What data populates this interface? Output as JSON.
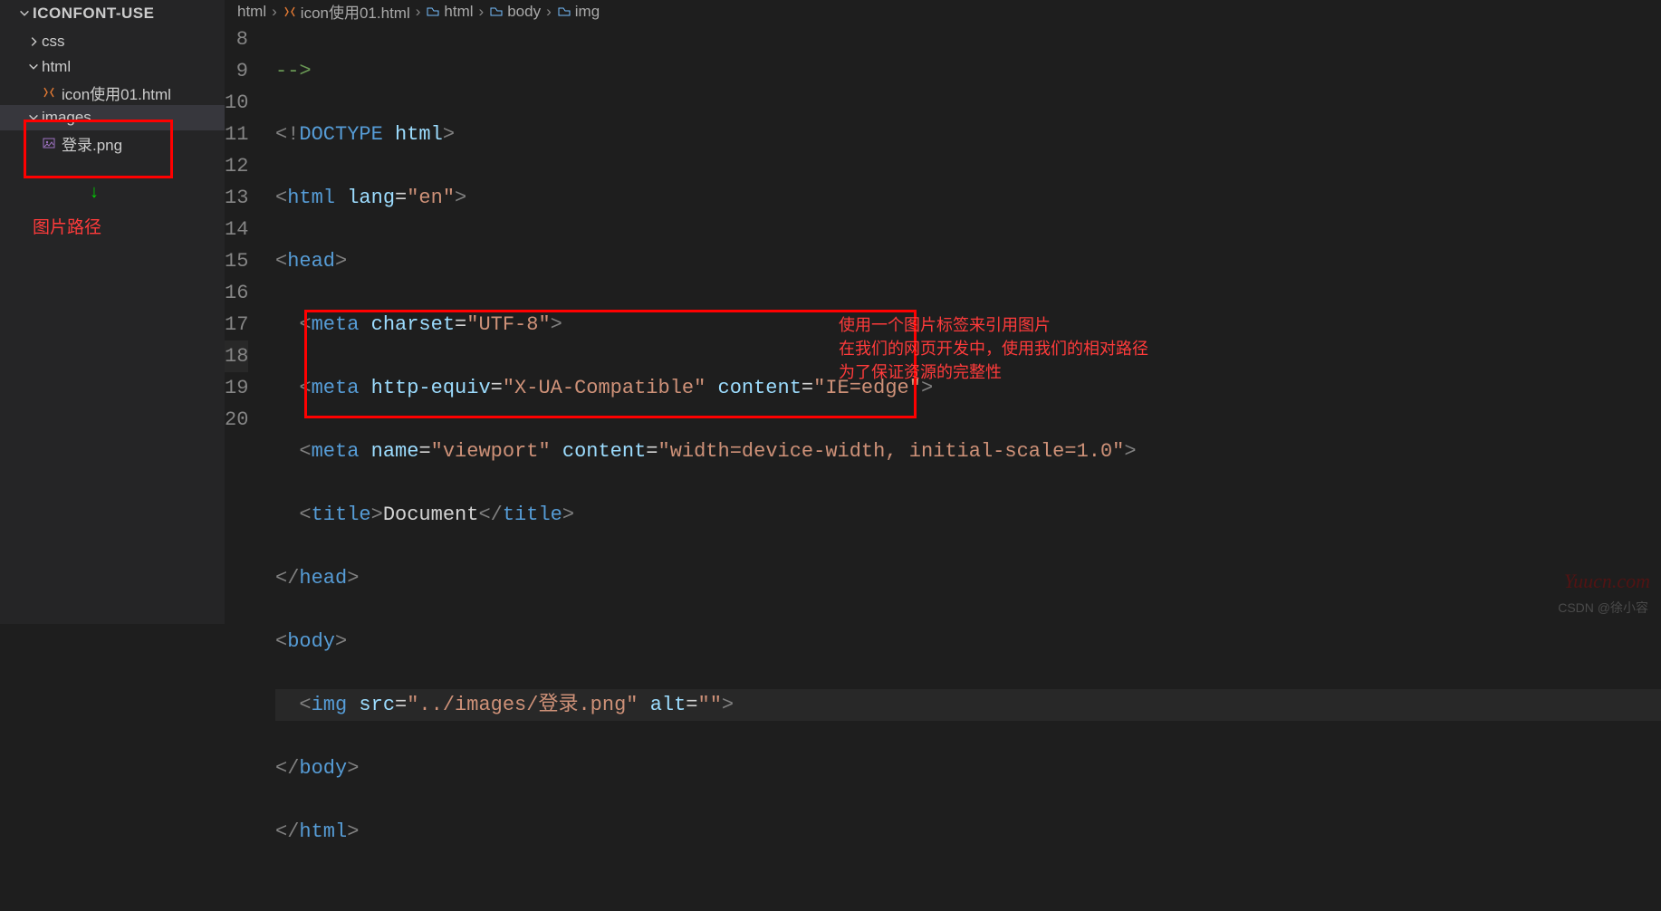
{
  "explorer": {
    "title": "ICONFONT-USE",
    "tree": {
      "css": "css",
      "html_folder": "html",
      "html_file": "icon使用01.html",
      "images_folder": "images",
      "image_file": "登录.png"
    }
  },
  "breadcrumbs": {
    "b1": "html",
    "b2": "icon使用01.html",
    "b3": "html",
    "b4": "body",
    "b5": "img"
  },
  "gutter": {
    "n8": "8",
    "n9": "9",
    "n10": "10",
    "n11": "11",
    "n12": "12",
    "n13": "13",
    "n14": "14",
    "n15": "15",
    "n16": "16",
    "n17": "17",
    "n18": "18",
    "n19": "19",
    "n20": "20"
  },
  "code": {
    "l8_comment": "-->",
    "doctype": "DOCTYPE",
    "html_word": "html",
    "lang_attr": "lang",
    "lang_val": "\"en\"",
    "head": "head",
    "meta": "meta",
    "charset_attr": "charset",
    "charset_val": "\"UTF-8\"",
    "httpequiv_attr": "http-equiv",
    "httpequiv_val": "\"X-UA-Compatible\"",
    "content_attr": "content",
    "content_val1": "\"IE=edge\"",
    "name_attr": "name",
    "name_val": "\"viewport\"",
    "content_val2": "\"width=device-width, initial-scale=1.0\"",
    "title": "title",
    "title_text": "Document",
    "body": "body",
    "img": "img",
    "src_attr": "src",
    "src_val": "\"../images/登录.png\"",
    "alt_attr": "alt",
    "alt_val": "\"\""
  },
  "annotations": {
    "path_label": "图片路径",
    "note_l1": "使用一个图片标签来引用图片",
    "note_l2": "在我们的网页开发中，使用我们的相对路径",
    "note_l3": "为了保证资源的完整性"
  },
  "watermark": {
    "w1": "Yuucn.com",
    "w2": "CSDN @徐小容"
  }
}
